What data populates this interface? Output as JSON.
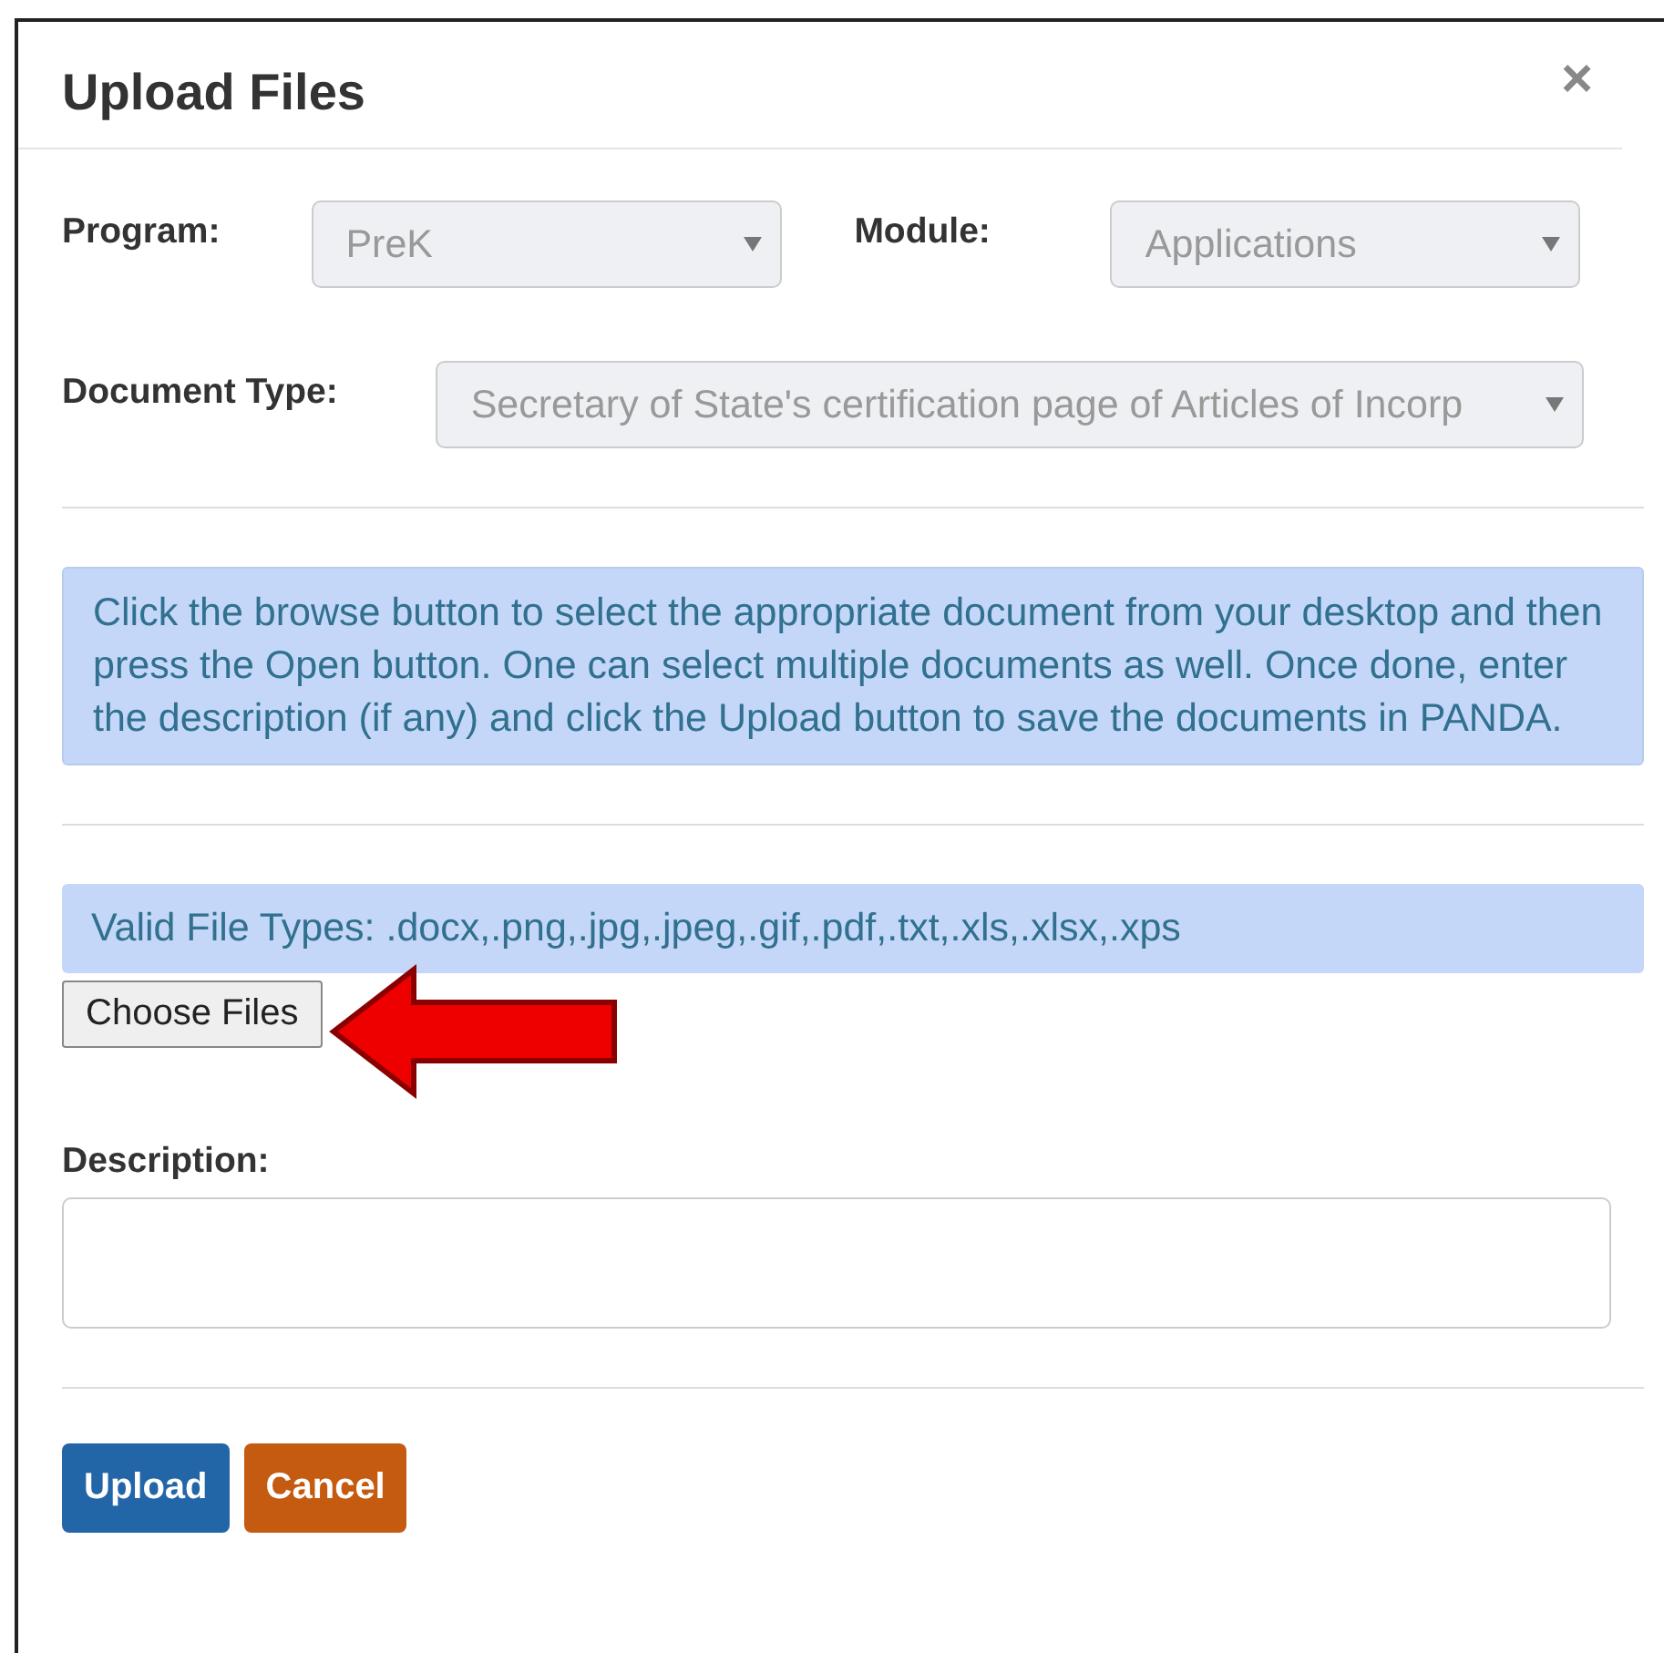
{
  "dialog": {
    "title": "Upload Files",
    "close": "×"
  },
  "fields": [
    {
      "label": "Program:",
      "value": "PreK",
      "disabled": true
    },
    {
      "label": "Module:",
      "value": "Applications",
      "disabled": true
    },
    {
      "label": "Document Type:",
      "value": "Secretary of State's certification page of Articles of Incorp",
      "disabled": true
    }
  ],
  "info": "Click the browse button to select the appropriate document from your desktop and then press the Open button. One can select multiple documents as well. Once done, enter the description (if any) and click the Upload button to save the documents in PANDA.",
  "valid_types": "Valid File Types: .docx,.png,.jpg,.jpeg,.gif,.pdf,.txt,.xls,.xlsx,.xps",
  "choose_button": "Choose Files",
  "description": {
    "label": "Description:"
  },
  "buttons": [
    {
      "label": "Upload",
      "kind": "primary"
    },
    {
      "label": "Cancel",
      "kind": "warning"
    }
  ]
}
